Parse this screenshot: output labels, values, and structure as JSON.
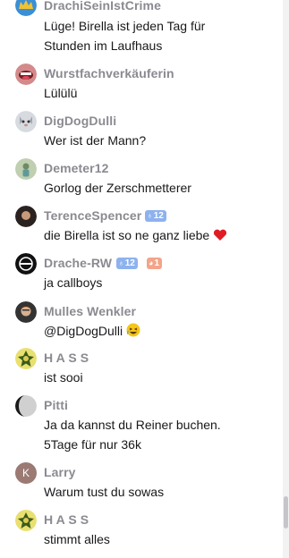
{
  "messages": [
    {
      "user": "DrachiSeinIstCrime",
      "lines": [
        "Lüge! Birella ist jeden Tag für",
        "Stunden im Laufhaus"
      ]
    },
    {
      "user": "Wurstfachverkäuferin",
      "lines": [
        "Lülülü"
      ]
    },
    {
      "user": "DigDogDulli",
      "lines": [
        "Wer ist der Mann?"
      ]
    },
    {
      "user": "Demeter12",
      "lines": [
        "Gorlog der Zerschmetterer"
      ]
    },
    {
      "user": "TerenceSpencer",
      "badge": "12",
      "lines": [
        "die Birella ist so ne ganz liebe"
      ],
      "emoji": "heart"
    },
    {
      "user": "Drache-RW",
      "badge": "12",
      "badge2": "1",
      "lines": [
        "ja callboys"
      ]
    },
    {
      "user": "Mulles Wenkler",
      "lines": [
        "@DigDogDulli"
      ],
      "emoji": "laughing"
    },
    {
      "user": "H A S S",
      "lines": [
        "ist sooi"
      ]
    },
    {
      "user": "Pitti",
      "lines": [
        "Ja da kannst du Reiner buchen.",
        "5Tage für nur 36k"
      ]
    },
    {
      "user": "Larry",
      "avatar_letter": "K",
      "lines": [
        "Warum tust du sowas"
      ]
    },
    {
      "user": "H A S S",
      "lines": [
        "stimmt alles"
      ]
    }
  ],
  "scroll": {
    "position": 0.95
  },
  "colors": {
    "username": "#8a8a91",
    "text": "#18181b",
    "sub_badge": "#8db2ef",
    "cheer_badge": "#f3a489"
  }
}
